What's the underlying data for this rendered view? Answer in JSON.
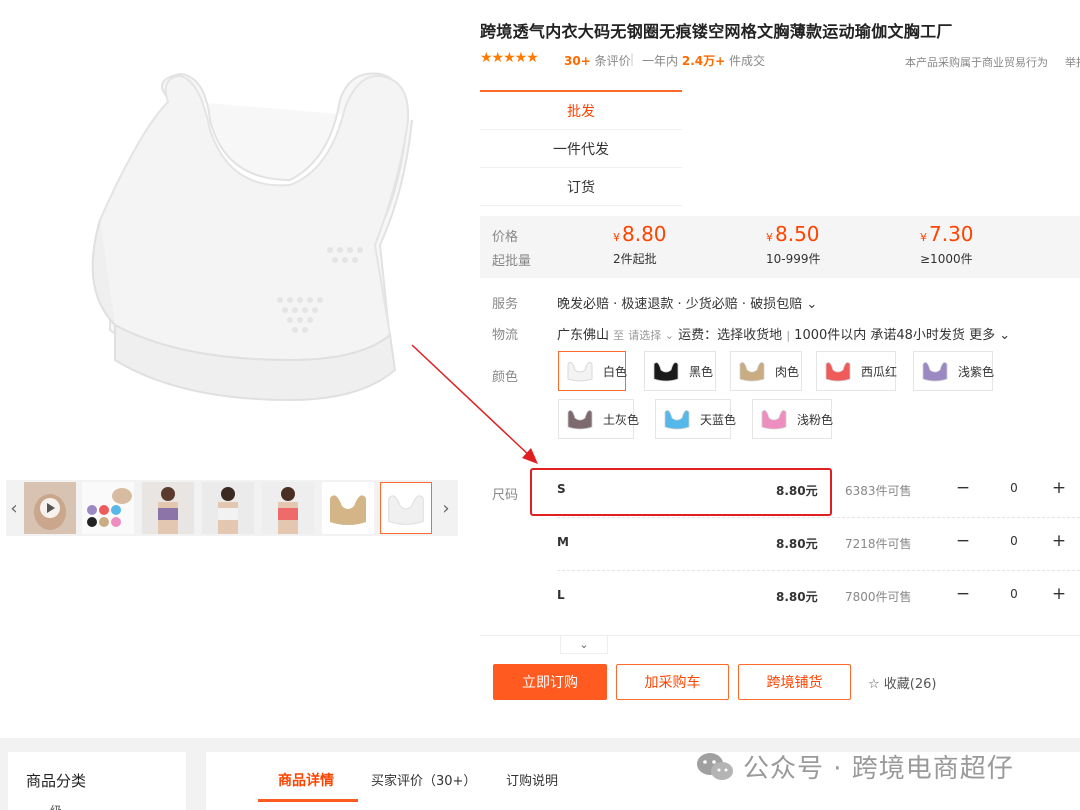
{
  "product": {
    "title": "跨境透气内衣大码无钢圈无痕镂空网格文胸薄款运动瑜伽文胸工厂",
    "rating_stars": "★★★★★",
    "reviews_count": "30+",
    "reviews_suffix": "条评价",
    "sold_prefix": "一年内",
    "sold_count": "2.4万+",
    "sold_suffix": "件成交",
    "purchase_note": "本产品采购属于商业贸易行为",
    "report_text": "举报"
  },
  "mode_tabs": [
    {
      "label": "批发",
      "active": true
    },
    {
      "label": "一件代发"
    },
    {
      "label": "订货"
    }
  ],
  "pricing": {
    "price_label": "价格",
    "moq_label": "起批量",
    "currency": "¥",
    "tiers": [
      {
        "price": "8.80",
        "qty": "2件起批"
      },
      {
        "price": "8.50",
        "qty": "10-999件"
      },
      {
        "price": "7.30",
        "qty": "≥1000件"
      }
    ]
  },
  "service": {
    "label": "服务",
    "text": "晚发必赔 · 极速退款 · 少货必赔 · 破损包赔 ⌄"
  },
  "logistics": {
    "label": "物流",
    "origin": "广东佛山",
    "to": "至",
    "select_placeholder": "请选择 ⌄",
    "freight": "运费：选择收货地",
    "divider": "|",
    "promise": "1000件以内 承诺48小时发货",
    "more": "更多 ⌄"
  },
  "colors": {
    "label": "颜色",
    "items": [
      {
        "name": "白色",
        "swatch": "#f3f3f3",
        "selected": true
      },
      {
        "name": "黑色",
        "swatch": "#1a1a1a"
      },
      {
        "name": "肉色",
        "swatch": "#c9ac82"
      },
      {
        "name": "西瓜红",
        "swatch": "#ef5a5a"
      },
      {
        "name": "浅紫色",
        "swatch": "#9b89c4"
      },
      {
        "name": "土灰色",
        "swatch": "#7d6a6e"
      },
      {
        "name": "天蓝色",
        "swatch": "#56b8e8"
      },
      {
        "name": "浅粉色",
        "swatch": "#ee8dbf"
      }
    ]
  },
  "sizes": {
    "label": "尺码",
    "rows": [
      {
        "name": "S",
        "price": "8.80元",
        "stock": "6383件可售",
        "qty": "0"
      },
      {
        "name": "M",
        "price": "8.80元",
        "stock": "7218件可售",
        "qty": "0"
      },
      {
        "name": "L",
        "price": "8.80元",
        "stock": "7800件可售",
        "qty": "0"
      }
    ],
    "minus": "−",
    "plus": "+"
  },
  "actions": {
    "buy": "立即订购",
    "cart": "加采购车",
    "crossborder": "跨境铺货",
    "favorite": "收藏(26)"
  },
  "bottom": {
    "category_title": "商品分类",
    "category_sub": "一级",
    "tabs": [
      "商品详情",
      "买家评价（30+）",
      "订购说明"
    ],
    "watermark": "公众号 · 跨境电商超仔"
  },
  "colors_theme": {
    "accent": "#ff5a1f",
    "price_red": "#ff4400",
    "star_orange": "#ff7a00",
    "highlight_red": "#e02020"
  },
  "gallery": {
    "thumbnail_count": 7,
    "selected_thumbnail": 7,
    "prev_icon": "chevron-left-icon",
    "next_icon": "chevron-right-icon"
  }
}
